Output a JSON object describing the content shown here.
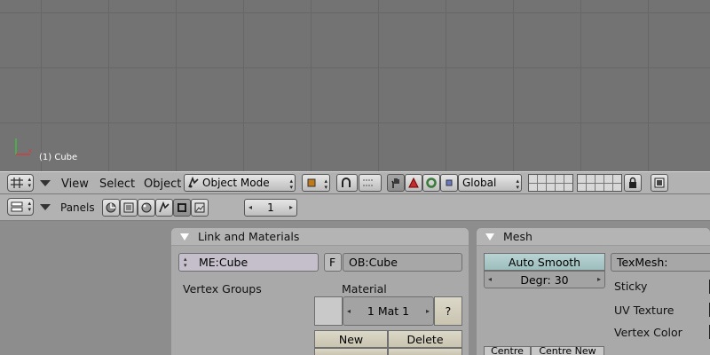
{
  "viewport": {
    "object_label": "(1) Cube"
  },
  "view_header": {
    "menus": {
      "view": "View",
      "select": "Select",
      "object": "Object"
    },
    "mode": "Object Mode",
    "orientation": "Global"
  },
  "buttons_header": {
    "panels_label": "Panels",
    "number": "1"
  },
  "link_materials": {
    "title": "Link and Materials",
    "mesh_field": "ME:Cube",
    "f_label": "F",
    "object_field": "OB:Cube",
    "vertex_groups": "Vertex Groups",
    "material_label": "Material",
    "material_value": "1 Mat 1",
    "help_label": "?",
    "new_label": "New",
    "delete_label": "Delete"
  },
  "mesh": {
    "title": "Mesh",
    "auto_smooth": "Auto Smooth",
    "degr": "Degr: 30",
    "texmesh": "TexMesh:",
    "sticky": "Sticky",
    "uv_texture": "UV Texture",
    "vertex_color": "Vertex Color",
    "centre": "Centre",
    "centre_new": "Centre New"
  }
}
